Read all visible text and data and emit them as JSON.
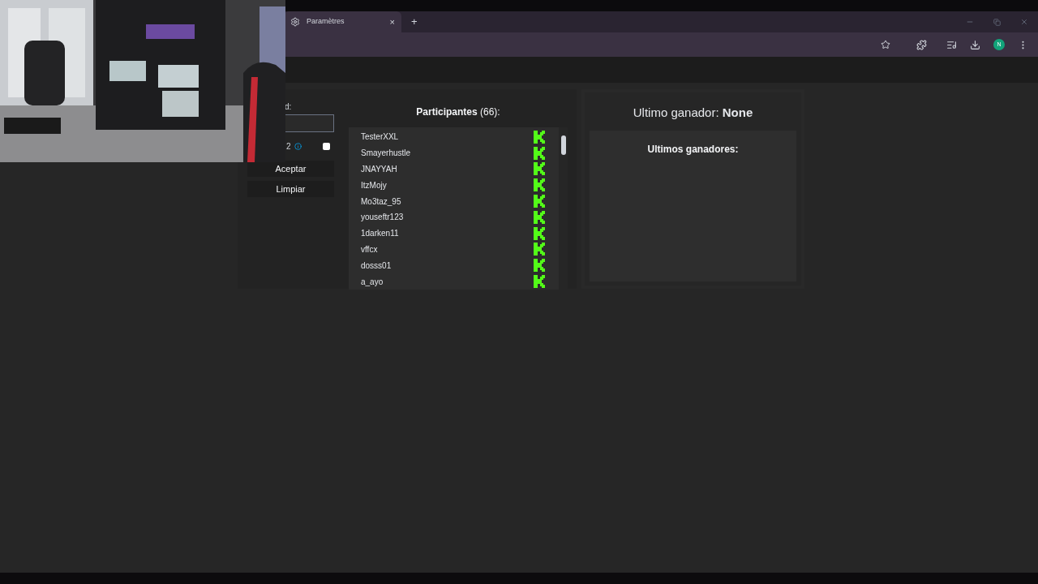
{
  "browser": {
    "tab": {
      "title": "Paramètres",
      "close": "×",
      "selected": true
    },
    "new_tab": "+",
    "avatar": "N"
  },
  "settings": {
    "field_label": "d:",
    "option_label": "2",
    "checkbox": {
      "checked": false
    },
    "buttons": [
      "Aceptar",
      "Limpiar"
    ]
  },
  "participants": {
    "title": "**Participantes** (66):",
    "items": [
      {
        "name": "TesterXXL",
        "kind": "kick"
      },
      {
        "name": "Smayerhustle",
        "kind": "kick"
      },
      {
        "name": "JNAYYAH",
        "kind": "kick"
      },
      {
        "name": "ItzMojy",
        "kind": "kick"
      },
      {
        "name": "Mo3taz_95",
        "kind": "kick"
      },
      {
        "name": "youseftr123",
        "kind": "kick"
      },
      {
        "name": "1darken11",
        "kind": "kick"
      },
      {
        "name": "vffcx",
        "kind": "kick"
      },
      {
        "name": "dosss01",
        "kind": "kick"
      },
      {
        "name": "a_ayo",
        "kind": "kick"
      }
    ]
  },
  "winner": {
    "text": "Ultimo ganador: **None**"
  },
  "history": {
    "title": "Ultimos ganadores:"
  }
}
